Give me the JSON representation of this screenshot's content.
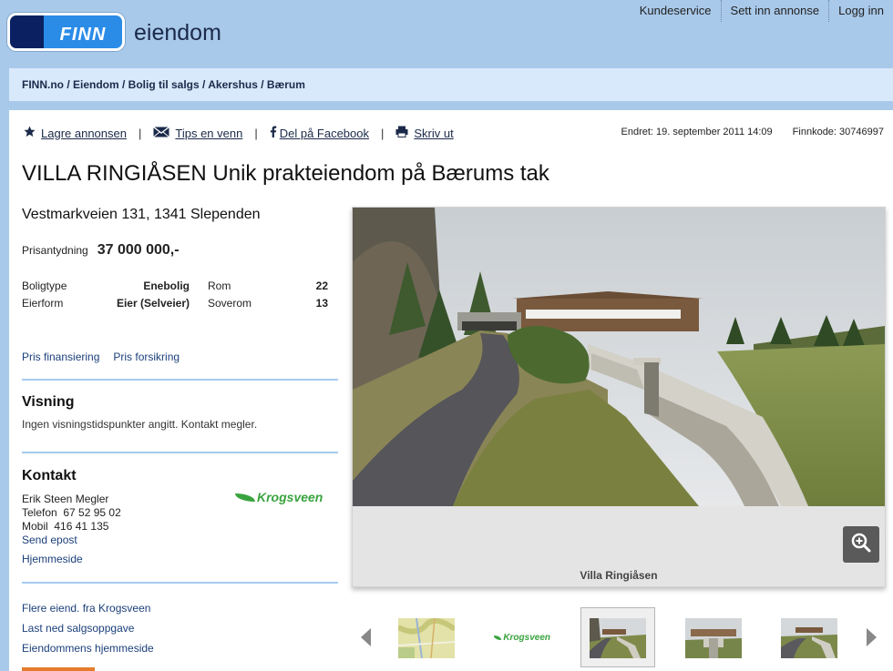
{
  "header": {
    "logo_text": "FINN",
    "section": "eiendom",
    "nav": [
      "Kundeservice",
      "Sett inn annonse",
      "Logg inn"
    ]
  },
  "breadcrumb": "FINN.no / Eiendom / Bolig til salgs / Akershus / Bærum",
  "actions": {
    "save": "Lagre annonsen",
    "tip": "Tips en venn",
    "facebook": "Del på Facebook",
    "print": "Skriv ut",
    "separator": "|"
  },
  "meta": {
    "changed_label": "Endret:",
    "changed_value": "19. september 2011 14:09",
    "code_label": "Finnkode:",
    "code_value": "30746997"
  },
  "listing": {
    "title": "VILLA RINGIÅSEN Unik prakteiendom på Bærums tak",
    "address": "Vestmarkveien 131, 1341 Slependen",
    "price_label": "Prisantydning",
    "price_value": "37 000 000,-",
    "facts": [
      {
        "k1": "Boligtype",
        "v1": "Enebolig",
        "k2": "Rom",
        "v2": "22"
      },
      {
        "k1": "Eierform",
        "v1": "Eier (Selveier)",
        "k2": "Soverom",
        "v2": "13"
      }
    ],
    "links": [
      "Pris finansiering",
      "Pris forsikring"
    ]
  },
  "visning": {
    "heading": "Visning",
    "text": "Ingen visningstidspunkter angitt. Kontakt megler."
  },
  "contact": {
    "heading": "Kontakt",
    "name": "Erik Steen Megler",
    "phone_label": "Telefon",
    "phone": "67 52 95 02",
    "mobile_label": "Mobil",
    "mobile": "416 41 135",
    "email_link": "Send epost",
    "homepage_link": "Hjemmeside",
    "agency_logo": "Krogsveen"
  },
  "more_links": [
    "Flere eiend. fra Krogsveen",
    "Last ned salgsoppgave",
    "Eiendommens hjemmeside"
  ],
  "viewer": {
    "caption": "Villa Ringiåsen",
    "thumb_logo": "Krogsveen"
  },
  "colors": {
    "background": "#a9c9ea",
    "breadcrumb_bg": "#d8e9fb",
    "link": "#1b3f7a",
    "finn_blue": "#2b8ce8",
    "finn_dark": "#0b2060",
    "krogsveen_green": "#3aa33f"
  },
  "icons": [
    "star-icon",
    "envelope-icon",
    "facebook-icon",
    "printer-icon",
    "zoom-in-icon",
    "arrow-left-icon",
    "arrow-right-icon"
  ]
}
